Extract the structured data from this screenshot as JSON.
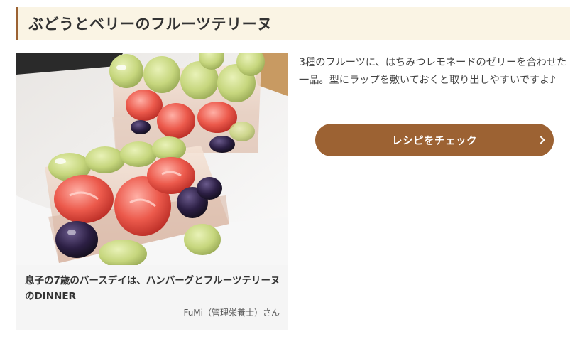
{
  "section": {
    "title": "ぶどうとベリーのフルーツテリーヌ"
  },
  "card": {
    "caption": "息子の7歳のバースデイは、ハンバーグとフルーツテリーヌのDINNER",
    "author": "FuMi（管理栄養士）さん"
  },
  "description": "3種のフルーツに、はちみつレモネードのゼリーを合わせた一品。型にラップを敷いておくと取り出しやすいですよ♪",
  "recipe_button": {
    "label": "レシピをチェック",
    "icon": "chevron-right-icon"
  },
  "colors": {
    "accent": "#9c6233",
    "header_background": "#faf4e4",
    "card_background": "#f5f5f5"
  }
}
